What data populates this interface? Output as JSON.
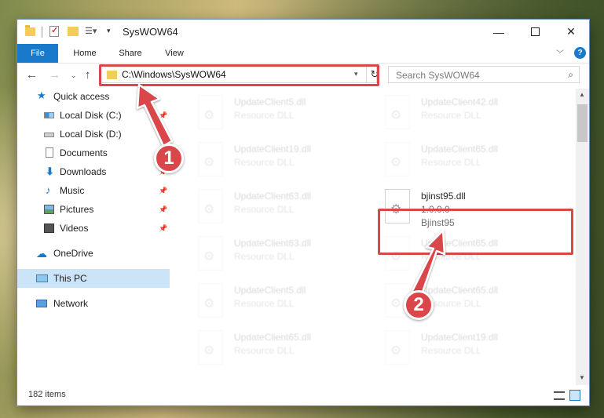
{
  "window": {
    "title": "SysWOW64"
  },
  "ribbon": {
    "tabs": [
      "File",
      "Home",
      "Share",
      "View"
    ],
    "help_label": "?"
  },
  "navbar": {
    "address_path": "C:\\Windows\\SysWOW64",
    "search_placeholder": "Search SysWOW64"
  },
  "sidebar": {
    "items": [
      {
        "label": "Quick access",
        "icon": "star-icon"
      },
      {
        "label": "Local Disk (C:)",
        "icon": "drive-icon",
        "pinned": true
      },
      {
        "label": "Local Disk (D:)",
        "icon": "drive-icon"
      },
      {
        "label": "Documents",
        "icon": "documents-icon",
        "pinned": true
      },
      {
        "label": "Downloads",
        "icon": "download-icon",
        "pinned": true
      },
      {
        "label": "Music",
        "icon": "music-icon",
        "pinned": true
      },
      {
        "label": "Pictures",
        "icon": "pictures-icon",
        "pinned": true
      },
      {
        "label": "Videos",
        "icon": "videos-icon",
        "pinned": true
      },
      {
        "label": "OneDrive",
        "icon": "cloud-icon"
      },
      {
        "label": "This PC",
        "icon": "computer-icon",
        "selected": true
      },
      {
        "label": "Network",
        "icon": "network-icon"
      }
    ]
  },
  "files": [
    {
      "name": "UpdateClient5.dll",
      "desc": "Resource DLL"
    },
    {
      "name": "UpdateClient42.dll",
      "desc": "Resource DLL"
    },
    {
      "name": "UpdateClient19.dll",
      "desc": "Resource DLL"
    },
    {
      "name": "UpdateClient65.dll",
      "desc": "Resource DLL"
    },
    {
      "name": "UpdateClient63.dll",
      "desc": "Resource DLL"
    },
    {
      "name": "bjinst95.dll",
      "desc": "1.0.0.0",
      "desc2": "Bjinst95",
      "highlighted": true
    },
    {
      "name": "UpdateClient63.dll",
      "desc": "Resource DLL"
    },
    {
      "name": "UpdateClient65.dll",
      "desc": "Resource DLL"
    },
    {
      "name": "UpdateClient5.dll",
      "desc": "Resource DLL"
    },
    {
      "name": "UpdateClient65.dll",
      "desc": "Resource DLL"
    },
    {
      "name": "UpdateClient65.dll",
      "desc": "Resource DLL"
    },
    {
      "name": "UpdateClient19.dll",
      "desc": "Resource DLL"
    }
  ],
  "status": {
    "item_count": "182 items"
  },
  "callouts": [
    "1",
    "2"
  ],
  "colors": {
    "accent": "#1979ca",
    "highlight_red": "#d9474b",
    "selection": "#cce4f7"
  }
}
